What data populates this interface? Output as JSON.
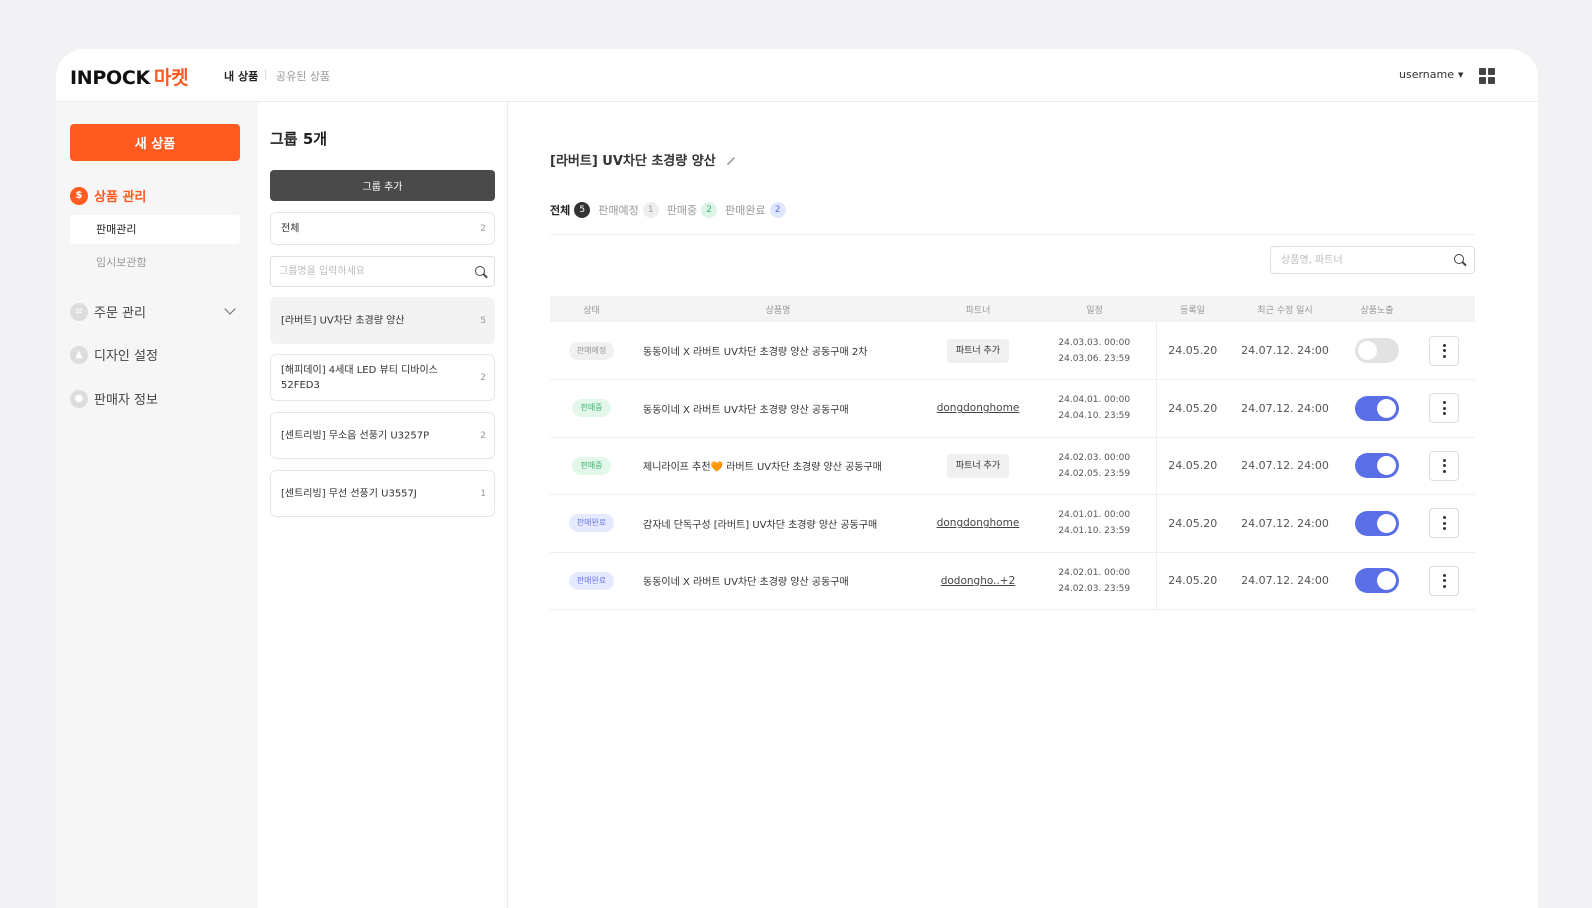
{
  "header": {
    "logo_text": "INPOCK",
    "logo_accent": "마켓",
    "nav_mine": "내 상품",
    "nav_shared": "공유된 상품",
    "username": "username"
  },
  "sidebar": {
    "new_product": "새 상품",
    "menus": [
      {
        "label": "상품 관리",
        "icon": "dollar-icon",
        "active": true
      },
      {
        "label": "주문 관리",
        "icon": "list-icon"
      },
      {
        "label": "디자인 설정",
        "icon": "image-icon"
      },
      {
        "label": "판매자 정보",
        "icon": "user-icon"
      }
    ],
    "sub_items": [
      "판매관리",
      "임시보관함"
    ]
  },
  "groups": {
    "title": "그룹 5개",
    "add_button": "그룹 추가",
    "all_label": "전체",
    "all_count": "2",
    "search_placeholder": "그룹명을 입력하세요",
    "items": [
      {
        "name": "[라버트] UV차단 초경량 양산",
        "count": "5"
      },
      {
        "name": "[해피데이] 4세대 LED 뷰티 디바이스 52FED3",
        "count": "2"
      },
      {
        "name": "[센트리빙] 무소음 선풍기 U3257P",
        "count": "2"
      },
      {
        "name": "[센트리빙] 무선 선풍기 U3557J",
        "count": "1"
      }
    ]
  },
  "main": {
    "title": "[라버트] UV차단 초경량 양산",
    "tabs": [
      {
        "label": "전체",
        "count": "5"
      },
      {
        "label": "판매예정",
        "count": "1"
      },
      {
        "label": "판매중",
        "count": "2"
      },
      {
        "label": "판매완료",
        "count": "2"
      }
    ],
    "search_placeholder": "상품명, 파트너",
    "columns": [
      "상태",
      "상품명",
      "파트너",
      "일정",
      "등록일",
      "최근 수정 일시",
      "상품노출"
    ],
    "rows": [
      {
        "status": "판매예정",
        "name": "동동이네 X 라버트 UV차단 초경량 양산 공동구매 2차",
        "partner": "파트너 추가",
        "start": "24.03.03. 00:00",
        "end": "24.03.06. 23:59",
        "registered": "24.05.20",
        "modified": "24.07.12. 24:00",
        "visible": "off"
      },
      {
        "status": "판매중",
        "name": "동동이네 X 라버트 UV차단 초경량 양산 공동구매",
        "partner": "dongdonghome",
        "start": "24.04.01. 00:00",
        "end": "24.04.10. 23:59",
        "registered": "24.05.20",
        "modified": "24.07.12. 24:00",
        "visible": "on"
      },
      {
        "status": "판매중",
        "name": "제니라이프 추천🧡 라버트 UV차단 초경량 양산 공동구매",
        "partner": "파트너 추가",
        "start": "24.02.03. 00:00",
        "end": "24.02.05. 23:59",
        "registered": "24.05.20",
        "modified": "24.07.12. 24:00",
        "visible": "on"
      },
      {
        "status": "판매완료",
        "name": "감자네 단독구성 [라버트] UV차단 초경량 양산 공동구매",
        "partner": "dongdonghome",
        "start": "24.01.01. 00:00",
        "end": "24.01.10. 23:59",
        "registered": "24.05.20",
        "modified": "24.07.12. 24:00",
        "visible": "on"
      },
      {
        "status": "판매완료",
        "name": "동동이네 X 라버트 UV차단 초경량 양산 공동구매",
        "partner": "dodongho..+2",
        "start": "24.02.01. 00:00",
        "end": "24.02.03. 23:59",
        "registered": "24.05.20",
        "modified": "24.07.12. 24:00",
        "visible": "on"
      }
    ]
  },
  "colors": {
    "accent": "#ff5a1f",
    "toggle_on": "#5a6ee6",
    "status_sale": "#3cb371"
  }
}
